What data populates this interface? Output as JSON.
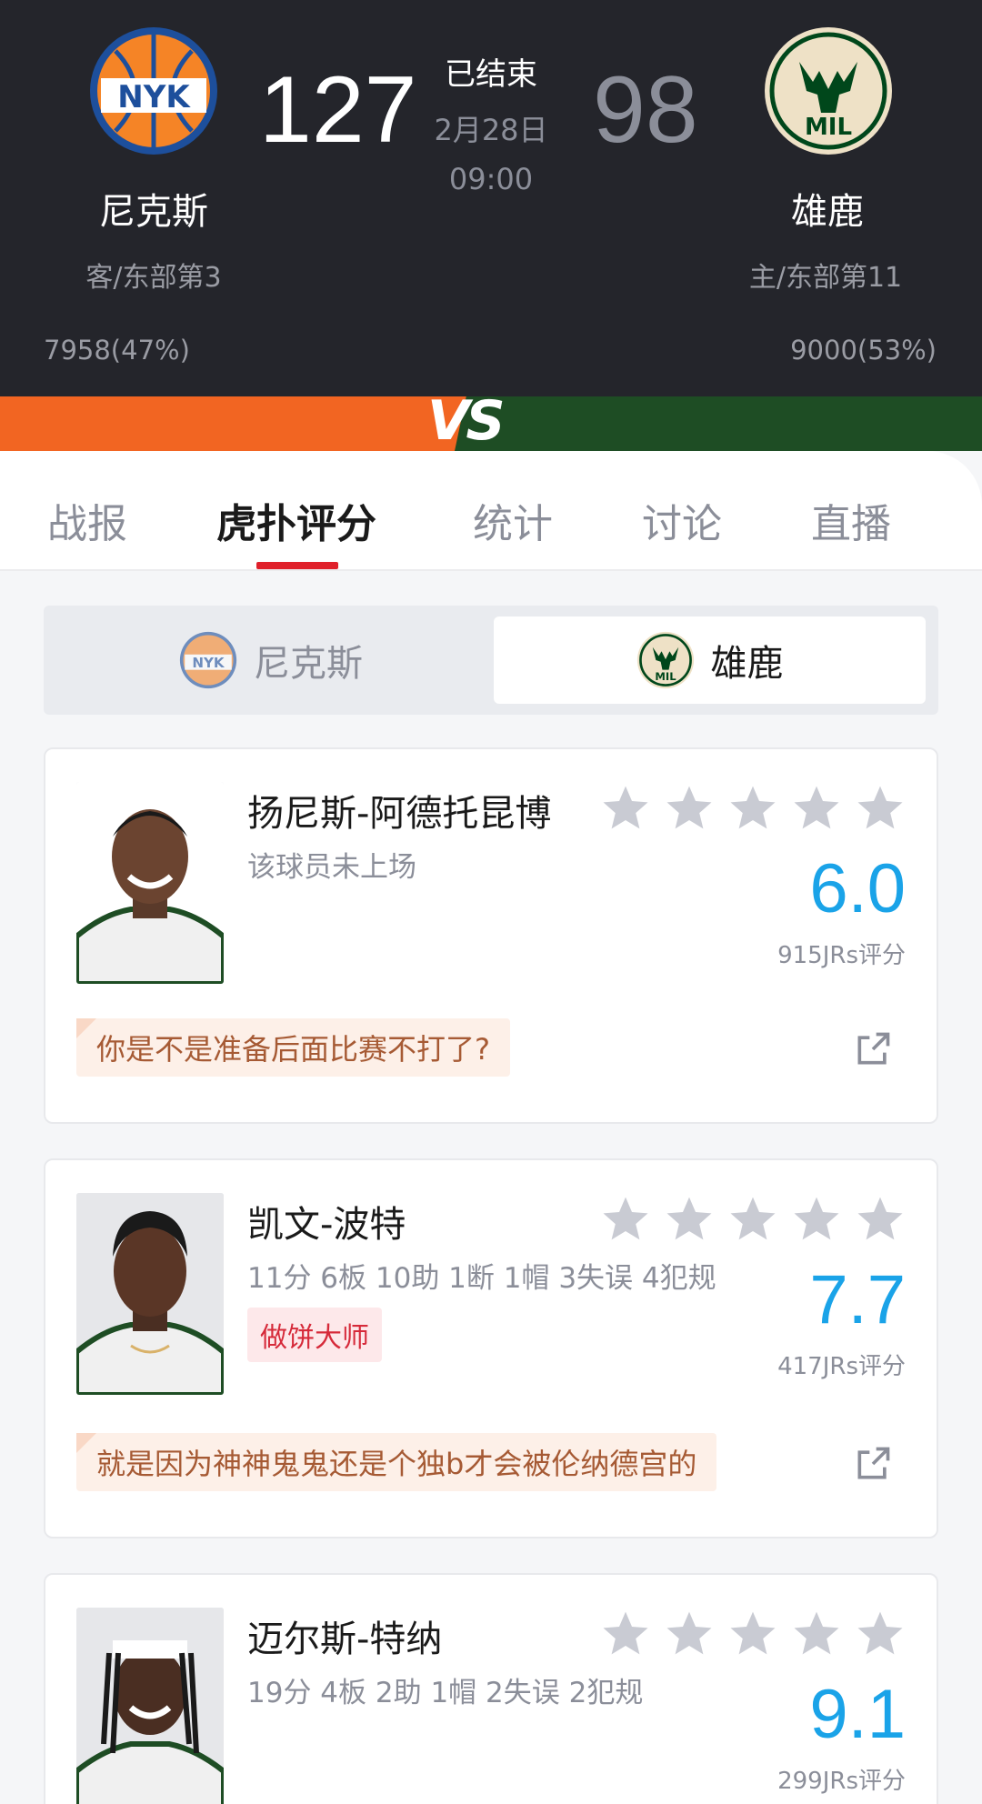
{
  "header": {
    "away_team": {
      "name": "尼克斯",
      "rank": "客/东部第3",
      "score": "127",
      "support": "7958(47%)",
      "logo_text": "NYK",
      "color": "#f26522"
    },
    "home_team": {
      "name": "雄鹿",
      "rank": "主/东部第11",
      "score": "98",
      "support": "9000(53%)",
      "logo_text": "MIL",
      "color": "#1e4d24"
    },
    "status": "已结束",
    "date": "2月28日",
    "time": "09:00",
    "vs_label": "VS"
  },
  "tabs": [
    {
      "label": "战报",
      "active": false
    },
    {
      "label": "虎扑评分",
      "active": true
    },
    {
      "label": "统计",
      "active": false
    },
    {
      "label": "讨论",
      "active": false
    },
    {
      "label": "直播",
      "active": false
    }
  ],
  "team_toggle": {
    "left": {
      "label": "尼克斯",
      "selected": false
    },
    "right": {
      "label": "雄鹿",
      "selected": true
    }
  },
  "players": [
    {
      "name": "扬尼斯-阿德托昆博",
      "stats": "该球员未上场",
      "badge": "",
      "stars_filled": 0,
      "rating": "6.0",
      "jrs": "915JRs评分",
      "comment": "你是不是准备后面比赛不打了?"
    },
    {
      "name": "凯文-波特",
      "stats": "11分 6板 10助 1断 1帽 3失误 4犯规",
      "badge": "做饼大师",
      "stars_filled": 0,
      "rating": "7.7",
      "jrs": "417JRs评分",
      "comment": "就是因为神神鬼鬼还是个独b才会被伦纳德宫的"
    },
    {
      "name": "迈尔斯-特纳",
      "stats": "19分 4板 2助 1帽 2失误 2犯规",
      "badge": "",
      "stars_filled": 0,
      "rating": "9.1",
      "jrs": "299JRs评分",
      "comment": ""
    }
  ],
  "colors": {
    "accent_red": "#e0202b",
    "rating_blue": "#1aa3e8",
    "star_gray": "#c9cbd3"
  }
}
